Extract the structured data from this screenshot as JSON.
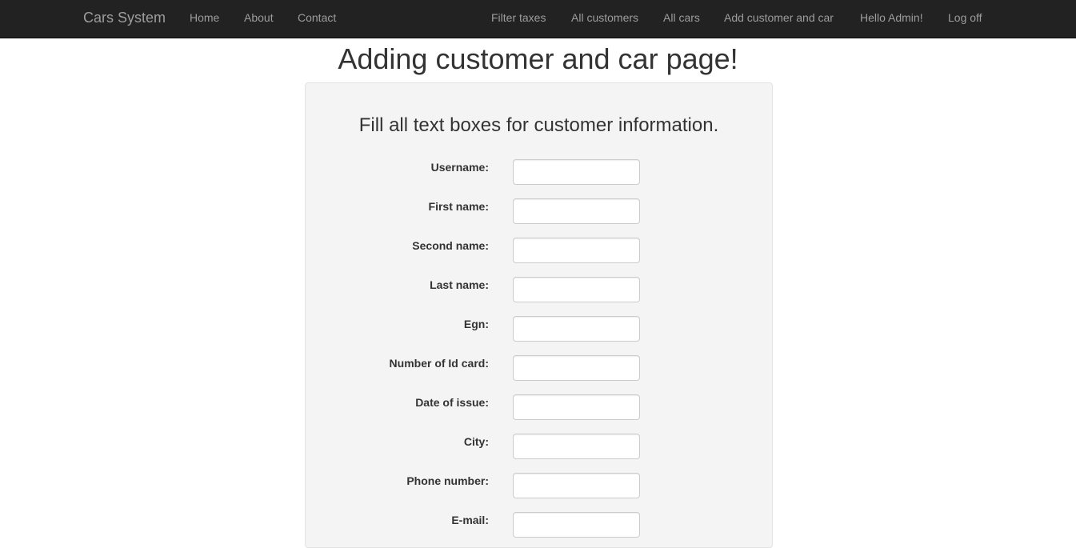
{
  "navbar": {
    "brand": "Cars System",
    "left_links": [
      "Home",
      "About",
      "Contact"
    ],
    "right_links": [
      "Filter taxes",
      "All customers",
      "All cars",
      "Add customer and car",
      "Hello Admin!",
      "Log off"
    ]
  },
  "page": {
    "title": "Adding customer and car page!"
  },
  "form": {
    "heading": "Fill all text boxes for customer information.",
    "fields": [
      {
        "label": "Username:",
        "value": ""
      },
      {
        "label": "First name:",
        "value": ""
      },
      {
        "label": "Second name:",
        "value": ""
      },
      {
        "label": "Last name:",
        "value": ""
      },
      {
        "label": "Egn:",
        "value": ""
      },
      {
        "label": "Number of Id card:",
        "value": ""
      },
      {
        "label": "Date of issue:",
        "value": ""
      },
      {
        "label": "City:",
        "value": ""
      },
      {
        "label": "Phone number:",
        "value": ""
      },
      {
        "label": "E-mail:",
        "value": ""
      }
    ]
  },
  "colors": {
    "navbar_bg": "#222222",
    "nav_text": "#9d9d9d",
    "panel_bg": "#f4f4f4"
  }
}
